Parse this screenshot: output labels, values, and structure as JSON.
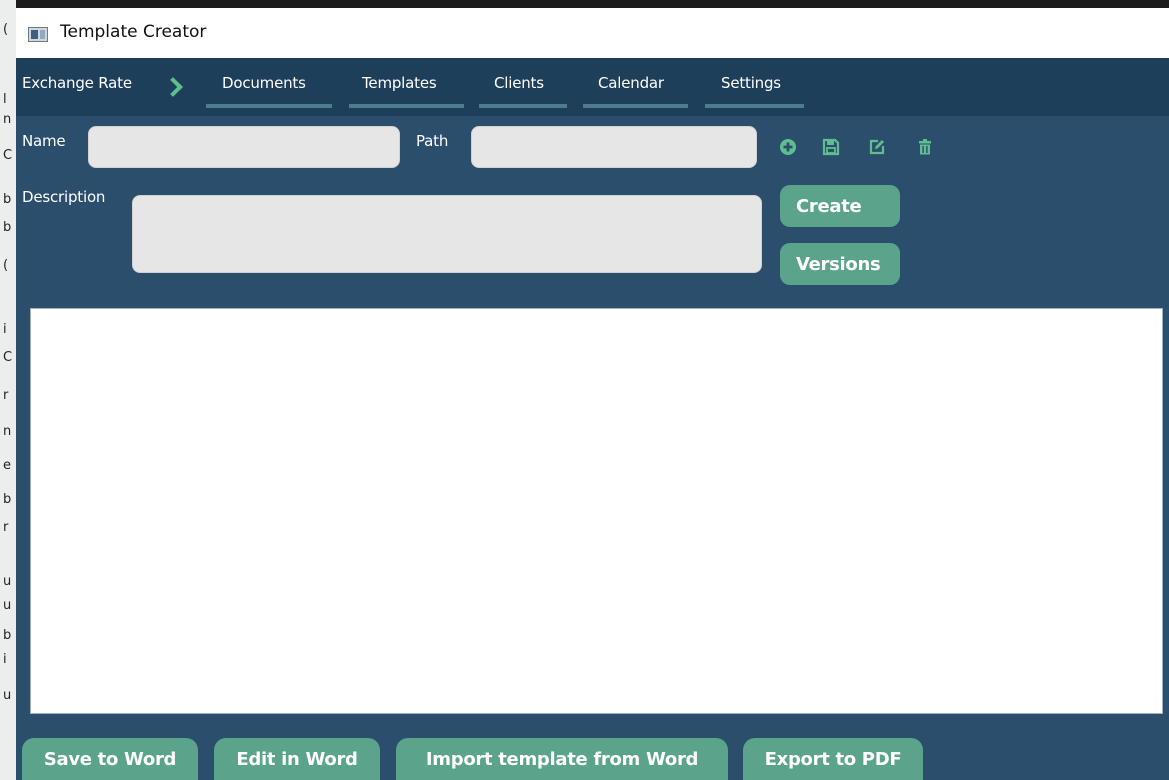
{
  "window": {
    "title": "Template Creator"
  },
  "background_glyphs": [
    "(",
    "l",
    "n",
    "C",
    "b",
    "b",
    "(",
    "i",
    "C",
    "r",
    "n",
    "e",
    "b",
    "r",
    "u",
    "u",
    "b",
    "i",
    "u"
  ],
  "nav": {
    "exchange_rate": "Exchange Rate",
    "tabs": [
      {
        "label": "Documents"
      },
      {
        "label": "Templates"
      },
      {
        "label": "Clients"
      },
      {
        "label": "Calendar"
      },
      {
        "label": "Settings"
      }
    ]
  },
  "form": {
    "name_label": "Name",
    "name_value": "",
    "path_label": "Path",
    "path_value": "",
    "description_label": "Description",
    "description_value": ""
  },
  "toolbar_icons": [
    "plus-circle-icon",
    "save-icon",
    "edit-icon",
    "trash-icon"
  ],
  "buttons": {
    "create": "Create",
    "versions": "Versions"
  },
  "bottom_buttons": {
    "save_to_word": "Save to Word",
    "edit_in_word": "Edit in Word",
    "import_template": "Import template from Word",
    "export_pdf": "Export to PDF"
  },
  "colors": {
    "background": "#2a4e6c",
    "navbar": "#1e3f5a",
    "accent_green": "#5ba38a",
    "icon_green": "#5fbf8c",
    "field_bg": "#e6e6e6"
  }
}
